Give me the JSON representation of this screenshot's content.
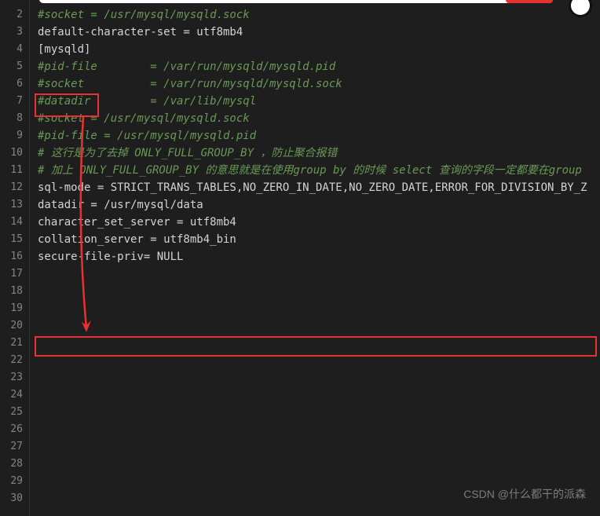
{
  "gutter": {
    "start": 2,
    "end": 30
  },
  "lines": {
    "l2": "",
    "l3": "#socket = /usr/mysql/mysqld.sock",
    "l4": "",
    "l5": "default-character-set = utf8mb4",
    "l6": "",
    "l7": "[mysqld]",
    "l8": "",
    "l9": "#pid-file        = /var/run/mysqld/mysqld.pid",
    "l10": "",
    "l11": "#socket          = /var/run/mysqld/mysqld.sock",
    "l12": "",
    "l13": "#datadir         = /var/lib/mysql",
    "l14": "",
    "l15": "#socket = /usr/mysql/mysqld.sock",
    "l16": "",
    "l17": "#pid-file = /usr/mysql/mysqld.pid",
    "l18": "",
    "l19": "# 这行是为了去掉 ONLY_FULL_GROUP_BY ，防止聚合报错",
    "l20": "# 加上 ONLY_FULL_GROUP_BY 的意思就是在使用group by 的时候 select 查询的字段一定都要在group",
    "l21": "sql-mode = STRICT_TRANS_TABLES,NO_ZERO_IN_DATE,NO_ZERO_DATE,ERROR_FOR_DIVISION_BY_Z",
    "l22": "",
    "l23": "datadir = /usr/mysql/data",
    "l24": "",
    "l25": "character_set_server = utf8mb4",
    "l26": "",
    "l27": "collation_server = utf8mb4_bin",
    "l28": "",
    "l29": "secure-file-priv= NULL",
    "l30": ""
  },
  "watermark": "CSDN @什么都干的派森",
  "annotations": {
    "box1_target_line": 7,
    "box2_target_line": 21,
    "arrow_color": "#e63232"
  }
}
